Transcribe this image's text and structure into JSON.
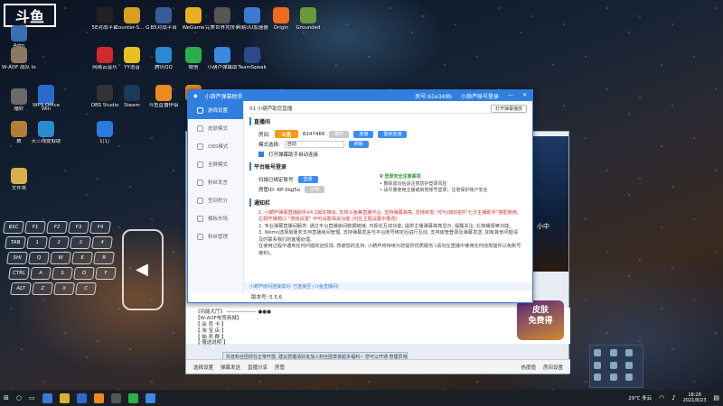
{
  "desktop": {
    "brand": "斗鱼",
    "icons": [
      {
        "label": "Adm",
        "color": "#3a6fb0"
      },
      {
        "label": "W-AOF 战队 logo",
        "color": "#8a7a60"
      },
      {
        "label": "赠好",
        "color": "#6a6a6a"
      },
      {
        "label": "数",
        "color": "#b0803a"
      },
      {
        "label": "文件夹",
        "color": "#d8b04a"
      },
      {
        "label": "Win",
        "color": "#2a6ad0"
      },
      {
        "label": "5E对战平台",
        "color": "#222"
      },
      {
        "label": "Counter-S... Global Off...",
        "color": "#d6a020"
      },
      {
        "label": "B5对战平台",
        "color": "#3a5a9a"
      },
      {
        "label": "WeGame",
        "color": "#e8b020"
      },
      {
        "label": "完美世界竞技平台",
        "color": "#555"
      },
      {
        "label": "网易UU加速器",
        "color": "#3a7ad0"
      },
      {
        "label": "Origin",
        "color": "#f06a20"
      },
      {
        "label": "Grounded",
        "color": "#6a9a3a"
      },
      {
        "label": "网易云音乐",
        "color": "#d02a2a"
      },
      {
        "label": "YY语音",
        "color": "#e8c020"
      },
      {
        "label": "腾讯QQ",
        "color": "#2a8ad0"
      },
      {
        "label": "微信",
        "color": "#2ab04a"
      },
      {
        "label": "小葫芦弹幕助",
        "color": "#3a8ae0"
      },
      {
        "label": "TeamSpeak",
        "color": "#2a4a8a"
      },
      {
        "label": "WPS Office",
        "color": "#2a6ad0"
      },
      {
        "label": "OBS Studio",
        "color": "#333"
      },
      {
        "label": "Steam",
        "color": "#1a3a5a"
      },
      {
        "label": "斗鱼直播伴侣",
        "color": "#f08a20"
      },
      {
        "label": "斗鱼",
        "color": "#f08a20"
      },
      {
        "label": "天三线提取助",
        "color": "#2a8ad0"
      },
      {
        "label": "钉钉",
        "color": "#2a7ae0"
      }
    ]
  },
  "keyboard": {
    "keys": [
      "ESC",
      "F1",
      "F2",
      "F3",
      "F4",
      "TAB",
      "1",
      "2",
      "3",
      "4",
      "SHI",
      "Q",
      "W",
      "E",
      "R",
      "CTRL",
      "A",
      "S",
      "D",
      "F",
      "ALT",
      "Z",
      "X",
      "C"
    ]
  },
  "app": {
    "title": "小葫芦弹幕助手",
    "title_right": [
      "房号:61e349b",
      "小葫芦账号登录"
    ],
    "sidebar": [
      "游戏设置",
      "皮肤模式",
      "OBS模式",
      "全屏模式",
      "粉丝发言",
      "签到积分",
      "模板市场",
      "粉丝管理"
    ],
    "topline": {
      "left": "01  小葫芦助您直播",
      "right_button": "打开弹幕播放"
    },
    "section_live": {
      "heading": "直播间",
      "room_label": "房间:",
      "platform": "斗鱼",
      "room_id": "8247466",
      "btn_disconnect": "断开",
      "btn_connect": "连接",
      "btn_reconnect": "重新连接",
      "mode_label": "模式选择:",
      "mode_value": "自动",
      "mode_btn": "刷新",
      "checkbox_label": "打开弹幕助手自动连接"
    },
    "section_account": {
      "heading": "平台账号登录",
      "bind_label": "扫描已绑定账号",
      "bind_btn": "登录",
      "token_label": "房管ID: 6P-3lqJ5o",
      "token_btn": "注销",
      "tips_title": "登录安全注意事项",
      "tips": [
        "删除成功后请注意防护登录风险",
        "请尽量使用主播或房管账号登录，注意保护账户安全"
      ]
    },
    "section_notice": {
      "heading": "通知栏",
      "lines_red": [
        "1. 小葫芦弹幕直播助手V4.1版本推出, 支持斗鱼等直播平台, 支持弹幕高亮, 支持转发; 可与OBS插件\"七夕主播助手\"搭配使用,",
        "右侧开播窗口 \"游戏设置\" 中可设置相关功能 (可在主题设置中更改)"
      ],
      "lines_dark": [
        "2. 专业弹幕直播间服务: 通过平台直播房间数据链接, 可视化互动功能, 提供主播弹幕高亮显示, 提醒关注, 礼物播报等功能。",
        "3. Wemo选择房服务支持直播房间管理, 支持弹幕发言与平台账号绑定后进行互动, 支持房管登录及弹幕发送, 如有其他问题请及时联系我们的客服处理,",
        "在使用过程中遇到任何问题欢迎反馈, 感谢您的支持, 小葫芦将持续为您提供优质服务 (请勿在直播中使用任何违规插件以免账号被封)。"
      ]
    },
    "status": "小葫芦房间连接成功: 已连接至 (斗鱼直播间)",
    "version": "版本号: 5.5.6"
  },
  "chat": {
    "lines": [
      "《功能大厅》 —————— ●●●",
      "【W-AOF电竞商城】",
      "【 会 员 卡 】",
      "【 淘 宝 店 】",
      "【 抽 奖 群 】",
      "【 赠送说明 】"
    ],
    "notice": "抖音粉丝团现在正常开放, 建议您邀请好友加入粉丝团享受超多福利~ 您可以开通 管理员身份后您可",
    "bar": [
      "选择设置",
      "弹幕发送",
      "直播分享",
      "房管",
      "热度值",
      "房间设置"
    ],
    "ad": [
      "皮肤",
      "免费得"
    ],
    "video_tag": "小中"
  },
  "taskbar": {
    "weather": "29℃ 多云",
    "time": "18:28",
    "date": "2021/8/23"
  }
}
